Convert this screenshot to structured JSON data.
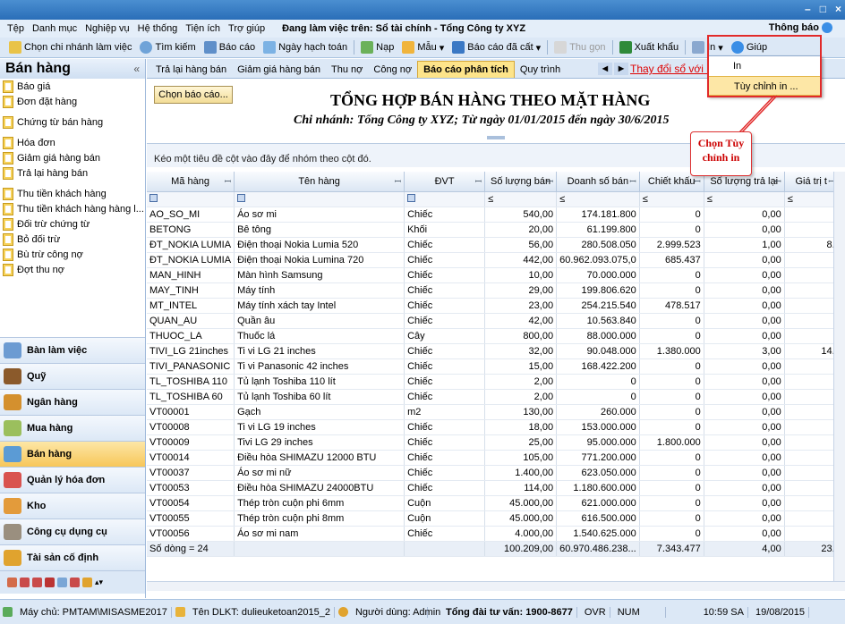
{
  "window": {
    "min": "–",
    "max": "□",
    "close": "×"
  },
  "menu": {
    "items": [
      "Tệp",
      "Danh mục",
      "Nghiệp vụ",
      "Hệ thống",
      "Tiện ích",
      "Trợ giúp"
    ],
    "context_label": "Đang làm việc trên: Sổ tài chính - Tổng Công ty XYZ",
    "notice": "Thông báo"
  },
  "toolbar": {
    "branch": "Chọn chi nhánh làm việc",
    "search": "Tìm kiếm",
    "report": "Báo cáo",
    "posting_date": "Ngày hạch toán",
    "load": "Nạp",
    "template": "Mẫu",
    "saved_reports": "Báo cáo đã cất",
    "collapse": "Thu gọn",
    "export": "Xuất khẩu",
    "print": "In",
    "help": "Giúp"
  },
  "print_menu": {
    "items": [
      "In",
      "Tùy chỉnh in ..."
    ]
  },
  "callout": "Chọn Tùy chỉnh in",
  "sidebar": {
    "title": "Bán hàng",
    "collapse": "«",
    "group1": [
      "Báo giá",
      "Đơn đặt hàng"
    ],
    "group2": [
      "Chứng từ bán hàng"
    ],
    "group3": [
      "Hóa đơn",
      "Giảm giá hàng bán",
      "Trả lại hàng bán"
    ],
    "group4": [
      "Thu tiền khách hàng",
      "Thu tiền khách hàng hàng l...",
      "Đối trừ chứng từ",
      "Bỏ đối trừ",
      "Bù trừ công nợ",
      "Đợt thu nợ"
    ],
    "modules": [
      "Bàn làm việc",
      "Quỹ",
      "Ngân hàng",
      "Mua hàng",
      "Bán hàng",
      "Quản lý hóa đơn",
      "Kho",
      "Công cụ dụng cụ",
      "Tài sản cố định"
    ],
    "active_module": "Bán hàng"
  },
  "tabs": [
    "Trả lại hàng bán",
    "Giảm giá hàng bán",
    "Thu nợ",
    "Công nợ",
    "Báo cáo phân tích",
    "Quy trình"
  ],
  "active_tab": "Báo cáo phân tích",
  "tab_link": "Thay đổi sổ với M",
  "report": {
    "choose_button": "Chọn báo cáo...",
    "title": "TỔNG HỢP BÁN HÀNG THEO MẶT HÀNG",
    "subtitle": "Chi nhánh: Tổng Công ty XYZ; Từ ngày 01/01/2015 đến ngày 30/6/2015",
    "group_hint": "Kéo một tiêu đề cột vào đây để nhóm theo cột đó."
  },
  "grid": {
    "columns": [
      "Mã hàng",
      "Tên hàng",
      "ĐVT",
      "Số lượng bán",
      "Doanh số bán",
      "Chiết khấu",
      "Số lượng trả lại",
      "Giá trị t"
    ],
    "filter_ops": [
      "",
      "",
      "",
      "≤",
      "≤",
      "≤",
      "≤",
      "≤"
    ],
    "rows": [
      [
        "AO_SO_MI",
        "Áo sơ mi",
        "Chiếc",
        "540,00",
        "174.181.800",
        "0",
        "0,00",
        ""
      ],
      [
        "BETONG",
        "Bê tông",
        "Khối",
        "20,00",
        "61.199.800",
        "0",
        "0,00",
        ""
      ],
      [
        "ĐT_NOKIA LUMIA",
        "Điện thoại Nokia Lumia 520",
        "Chiếc",
        "56,00",
        "280.508.050",
        "2.999.523",
        "1,00",
        "8."
      ],
      [
        "ĐT_NOKIA LUMIA",
        "Điện thoại Nokia Lumina 720",
        "Chiếc",
        "442,00",
        "60.962.093.075,0",
        "685.437",
        "0,00",
        ""
      ],
      [
        "MAN_HINH",
        "Màn hình Samsung",
        "Chiếc",
        "10,00",
        "70.000.000",
        "0",
        "0,00",
        ""
      ],
      [
        "MAY_TINH",
        "Máy tính",
        "Chiếc",
        "29,00",
        "199.806.620",
        "0",
        "0,00",
        ""
      ],
      [
        "MT_INTEL",
        "Máy tính xách tay Intel",
        "Chiếc",
        "23,00",
        "254.215.540",
        "478.517",
        "0,00",
        ""
      ],
      [
        "QUAN_AU",
        "Quần âu",
        "Chiếc",
        "42,00",
        "10.563.840",
        "0",
        "0,00",
        ""
      ],
      [
        "THUOC_LA",
        "Thuốc lá",
        "Cây",
        "800,00",
        "88.000.000",
        "0",
        "0,00",
        ""
      ],
      [
        "TIVI_LG 21inches",
        "Ti vi LG 21 inches",
        "Chiếc",
        "32,00",
        "90.048.000",
        "1.380.000",
        "3,00",
        "14."
      ],
      [
        "TIVI_PANASONIC",
        "Ti vi Panasonic 42 inches",
        "Chiếc",
        "15,00",
        "168.422.200",
        "0",
        "0,00",
        ""
      ],
      [
        "TL_TOSHIBA 110",
        "Tủ lạnh Toshiba 110 lít",
        "Chiếc",
        "2,00",
        "0",
        "0",
        "0,00",
        ""
      ],
      [
        "TL_TOSHIBA 60",
        "Tủ lạnh Toshiba 60 lít",
        "Chiếc",
        "2,00",
        "0",
        "0",
        "0,00",
        ""
      ],
      [
        "VT00001",
        "Gạch",
        "m2",
        "130,00",
        "260.000",
        "0",
        "0,00",
        ""
      ],
      [
        "VT00008",
        "Ti vi LG 19 inches",
        "Chiếc",
        "18,00",
        "153.000.000",
        "0",
        "0,00",
        ""
      ],
      [
        "VT00009",
        "Tivi LG 29 inches",
        "Chiếc",
        "25,00",
        "95.000.000",
        "1.800.000",
        "0,00",
        ""
      ],
      [
        "VT00014",
        "Điều hòa SHIMAZU 12000 BTU",
        "Chiếc",
        "105,00",
        "771.200.000",
        "0",
        "0,00",
        ""
      ],
      [
        "VT00037",
        "Áo sơ mi nữ",
        "Chiếc",
        "1.400,00",
        "623.050.000",
        "0",
        "0,00",
        ""
      ],
      [
        "VT00053",
        "Điều hòa SHIMAZU 24000BTU",
        "Chiếc",
        "114,00",
        "1.180.600.000",
        "0",
        "0,00",
        ""
      ],
      [
        "VT00054",
        "Thép tròn cuộn phi 6mm",
        "Cuộn",
        "45.000,00",
        "621.000.000",
        "0",
        "0,00",
        ""
      ],
      [
        "VT00055",
        "Thép tròn cuộn phi 8mm",
        "Cuộn",
        "45.000,00",
        "616.500.000",
        "0",
        "0,00",
        ""
      ],
      [
        "VT00056",
        "Áo sơ mi nam",
        "Chiếc",
        "4.000,00",
        "1.540.625.000",
        "0",
        "0,00",
        ""
      ]
    ],
    "footer": [
      "Số dòng = 24",
      "",
      "",
      "100.209,00",
      "60.970.486.238...",
      "7.343.477",
      "4,00",
      "23."
    ]
  },
  "status": {
    "server": "Máy chủ: PMTAM\\MISASME2017",
    "db": "Tên DLKT: dulieuketoan2015_2",
    "user": "Người dùng: Admin",
    "hotline": "Tổng đài tư vấn: 1900-8677",
    "ovr": "OVR",
    "num": "NUM",
    "time": "10:59 SA",
    "date": "19/08/2015"
  },
  "colors": {
    "accent": "#2a6eb8",
    "highlight": "#fde48a",
    "red": "#e12a2a"
  }
}
